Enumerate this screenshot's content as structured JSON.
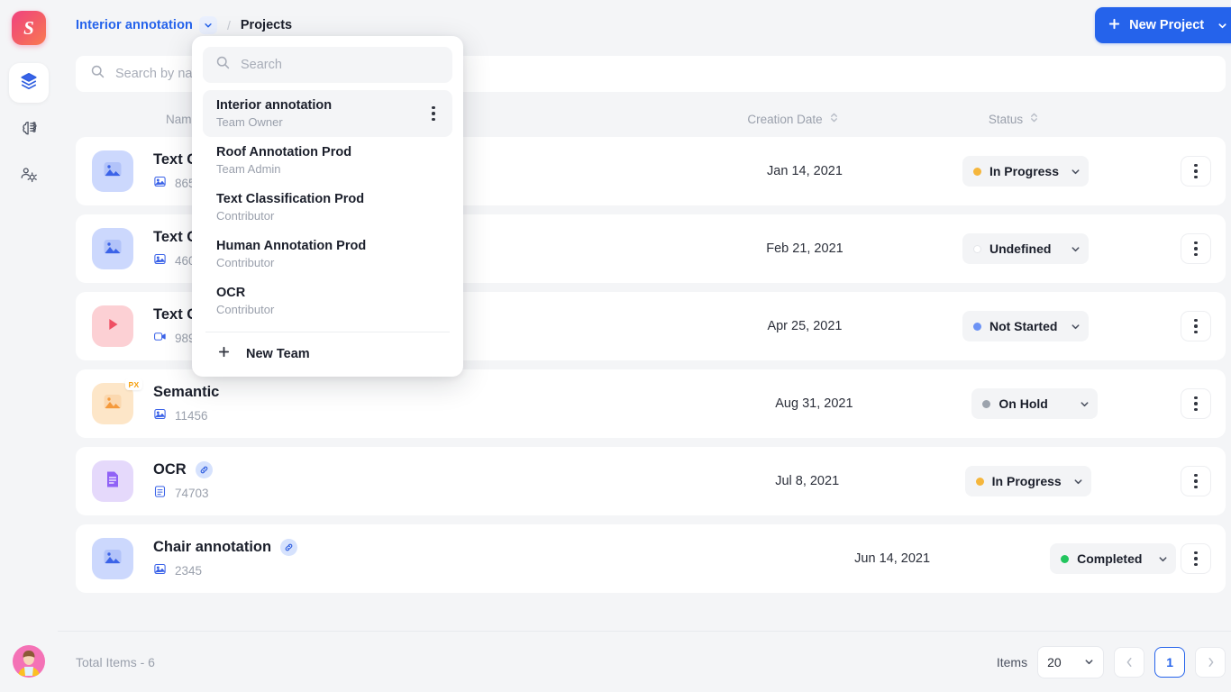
{
  "app": {
    "logo_letter": "S"
  },
  "sidebar": {
    "items": [
      {
        "name": "layers-icon",
        "label": "Projects",
        "active": true
      },
      {
        "name": "brain-icon",
        "label": "Models",
        "active": false
      },
      {
        "name": "team-settings-icon",
        "label": "Team",
        "active": false
      }
    ]
  },
  "topbar": {
    "team_name": "Interior annotation",
    "separator": "/",
    "page_title": "Projects",
    "new_project_label": "New Project"
  },
  "search": {
    "placeholder": "Search by name",
    "value": ""
  },
  "table": {
    "columns": {
      "name": "Name",
      "date": "Creation Date",
      "status": "Status"
    },
    "rows": [
      {
        "title": "Text Cla",
        "count": "8652",
        "date": "Jan 14, 2021",
        "status": "In Progress",
        "status_color": "#f5b63c",
        "thumb": "image-icon",
        "thumb_color": "blue",
        "count_icon": "image-icon",
        "linked": false
      },
      {
        "title": "Text Cla",
        "count": "4601",
        "date": "Feb 21, 2021",
        "status": "Undefined",
        "status_color": "#ffffff",
        "thumb": "image-icon",
        "thumb_color": "blue",
        "count_icon": "image-icon",
        "linked": false
      },
      {
        "title": "Text Cla",
        "count": "98921",
        "date": "Apr 25, 2021",
        "status": "Not Started",
        "status_color": "#6d93f5",
        "thumb": "video-icon",
        "thumb_color": "pink",
        "count_icon": "video-icon",
        "linked": false
      },
      {
        "title": "Semantic",
        "count": "11456",
        "date": "Aug 31, 2021",
        "status": "On Hold",
        "status_color": "#9ca3ad",
        "thumb": "image-icon",
        "thumb_color": "orange",
        "count_icon": "image-icon",
        "linked": false,
        "badge": "PX"
      },
      {
        "title": "OCR",
        "count": "74703",
        "date": "Jul 8, 2021",
        "status": "In Progress",
        "status_color": "#f5b63c",
        "thumb": "document-icon",
        "thumb_color": "purple",
        "count_icon": "document-icon",
        "linked": true
      },
      {
        "title": "Chair annotation",
        "count": "2345",
        "date": "Jun 14, 2021",
        "status": "Completed",
        "status_color": "#22c55e",
        "thumb": "image-icon",
        "thumb_color": "blue",
        "count_icon": "image-icon",
        "linked": true
      }
    ]
  },
  "footer": {
    "total_items": "Total Items - 6",
    "items_label": "Items",
    "page_size": "20",
    "current_page": "1"
  },
  "dropdown": {
    "search_placeholder": "Search",
    "teams": [
      {
        "name": "Interior annotation",
        "role": "Team Owner",
        "selected": true
      },
      {
        "name": "Roof Annotation Prod",
        "role": "Team Admin",
        "selected": false
      },
      {
        "name": "Text Classification Prod",
        "role": "Contributor",
        "selected": false
      },
      {
        "name": "Human Annotation Prod",
        "role": "Contributor",
        "selected": false
      },
      {
        "name": "OCR",
        "role": "Contributor",
        "selected": false
      }
    ],
    "new_team_label": "New Team"
  },
  "colors": {
    "accent": "#2563eb",
    "brand": "#f0437f"
  }
}
